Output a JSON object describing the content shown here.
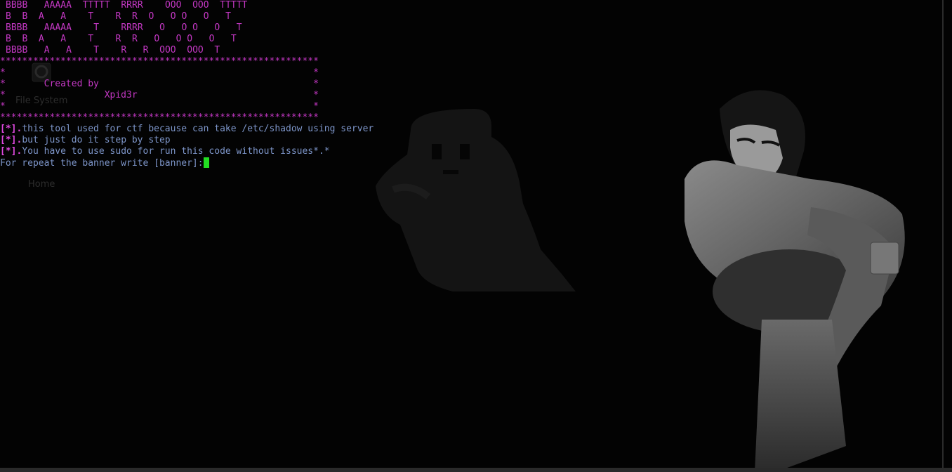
{
  "desktop": {
    "icons": [
      {
        "label": "File System",
        "icon": "drive-icon"
      },
      {
        "label": "Home",
        "icon": "home-folder-icon"
      }
    ],
    "wallpaper": {
      "elements": [
        "pixel-ghost",
        "sitting-figure"
      ]
    }
  },
  "terminal": {
    "banner_lines": [
      "BBBB   AAAAA  TTTTT  RRRR    OOO  OOO  TTTTT",
      "B  B  A   A    T    R  R  O   O O   O   T",
      "BBBB   AAAAA    T    RRRR   O   O O   O   T",
      "B  B  A   A    T    R  R   O   O O   O   T",
      "BBBB   A   A    T    R   R  OOO  OOO  T"
    ],
    "box_border": "**********************************************************",
    "box_lines": [
      "*                                                        *",
      "*       Created by                                       *",
      "*                  Xpid3r                                *",
      "*                                                        *"
    ],
    "info_prefix": "[*].",
    "info_lines": [
      "this tool used for ctf because can take /etc/shadow using server",
      "but just do it step by step",
      "You have to use sudo for run this code without issues*.*"
    ],
    "prompt": "For repeat the banner write [banner]:"
  },
  "colors": {
    "banner": "#c438c4",
    "text": "#7d95c9",
    "bracket": "#e049e0",
    "cursor": "#22dd22",
    "background": "#030303"
  }
}
